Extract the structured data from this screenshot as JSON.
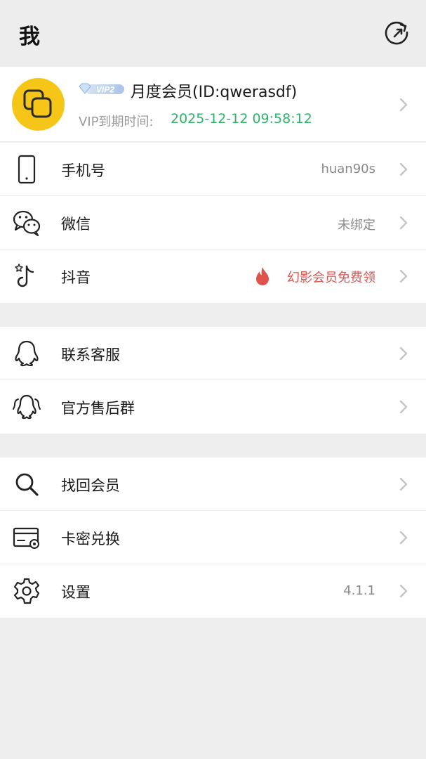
{
  "header": {
    "title": "我"
  },
  "profile": {
    "vip_badge": "VIP2",
    "member_title": "月度会员(ID:qwerasdf)",
    "expire_label": "VIP到期时间:",
    "expire_value": "2025-12-12 09:58:12"
  },
  "section1": [
    {
      "label": "手机号",
      "value": "huan90s",
      "icon": "phone-icon"
    },
    {
      "label": "微信",
      "value": "未绑定",
      "icon": "wechat-icon"
    },
    {
      "label": "抖音",
      "value": "幻影会员免费领",
      "icon": "douyin-icon"
    }
  ],
  "section2": [
    {
      "label": "联系客服",
      "icon": "qq-icon"
    },
    {
      "label": "官方售后群",
      "icon": "qq-group-icon"
    }
  ],
  "section3": [
    {
      "label": "找回会员",
      "icon": "search-icon"
    },
    {
      "label": "卡密兑换",
      "icon": "card-icon"
    },
    {
      "label": "设置",
      "value": "4.1.1",
      "icon": "gear-icon"
    }
  ],
  "colors": {
    "accent_green": "#2fb36b",
    "promo_red": "#e0524c",
    "avatar_yellow": "#f5c518"
  }
}
